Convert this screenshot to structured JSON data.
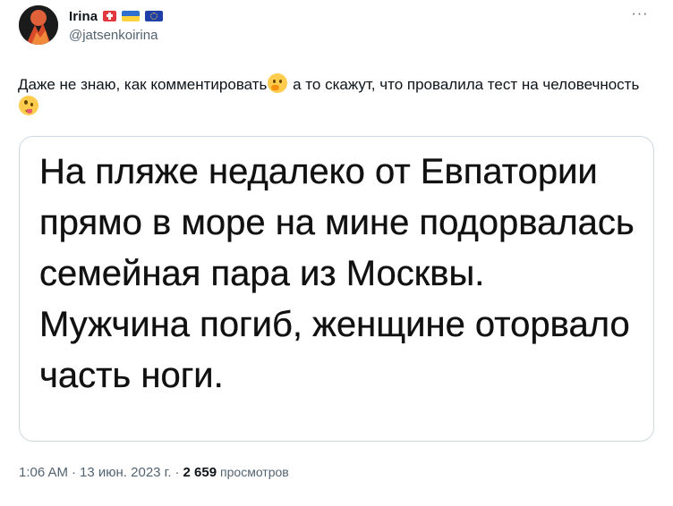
{
  "author": {
    "display_name": "Irina",
    "handle": "@jatsenkoirina"
  },
  "header": {
    "more_label": "···"
  },
  "tweet": {
    "text_part1": "Даже не знаю, как комментировать",
    "text_part2": " а то скажут, что провалила тест на человечность"
  },
  "media": {
    "caption": "На пляже недалеко от Евпатории прямо в море на мине подорвалась семейная пара из Москвы. Мужчина погиб, женщине оторвало часть ноги."
  },
  "meta": {
    "time": "1:06 AM",
    "dot1": "·",
    "date": "13 июн. 2023 г.",
    "dot2": "·",
    "views_count": "2 659",
    "views_label": "просмотров"
  },
  "icons": {
    "thinking": "thinking-face-icon",
    "zany": "zany-face-icon",
    "flags": [
      "switzerland-flag-icon",
      "ukraine-flag-icon",
      "eu-flag-icon"
    ]
  },
  "colors": {
    "text_primary": "#0f1419",
    "text_secondary": "#536471",
    "border": "#cfd9de"
  }
}
